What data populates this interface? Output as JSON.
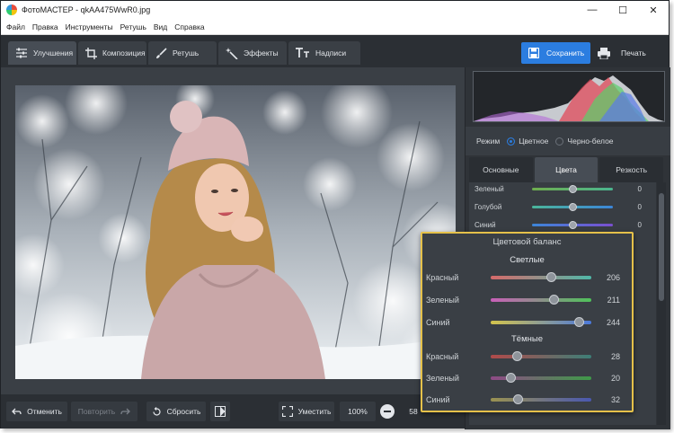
{
  "window": {
    "title": "ФотоМАСТЕР - qkAA475WwR0.jpg",
    "controls": [
      "—",
      "☐",
      "✕"
    ]
  },
  "menu": [
    "Файл",
    "Правка",
    "Инструменты",
    "Ретушь",
    "Вид",
    "Справка"
  ],
  "tabs": [
    {
      "label": "Улучшения",
      "icon": "sliders-icon",
      "active": true
    },
    {
      "label": "Композиция",
      "icon": "crop-icon",
      "active": false
    },
    {
      "label": "Ретушь",
      "icon": "brush-icon",
      "active": false
    },
    {
      "label": "Эффекты",
      "icon": "magic-wand-icon",
      "active": false
    },
    {
      "label": "Надписи",
      "icon": "text-icon",
      "active": false
    }
  ],
  "toolbar": {
    "save_label": "Сохранить",
    "print_label": "Печать"
  },
  "bottom": {
    "undo_label": "Отменить",
    "redo_label": "Повторить",
    "reset_label": "Сбросить",
    "fit_label": "Уместить",
    "zoom_label": "100%",
    "zoom_partial": "58"
  },
  "panel": {
    "mode_label": "Режим",
    "mode_options": [
      {
        "label": "Цветное",
        "selected": true
      },
      {
        "label": "Черно-белое",
        "selected": false
      }
    ],
    "tabs": [
      {
        "label": "Основные",
        "active": false
      },
      {
        "label": "Цвета",
        "active": true
      },
      {
        "label": "Резкость",
        "active": false
      }
    ],
    "rows": [
      {
        "label": "Зеленый",
        "value": "0",
        "fraction": 0.5
      },
      {
        "label": "Голубой",
        "value": "0",
        "fraction": 0.5
      },
      {
        "label": "Синий",
        "value": "0",
        "fraction": 0.5
      }
    ]
  },
  "color_balance": {
    "title": "Цветовой баланс",
    "light_title": "Светлые",
    "dark_title": "Тёмные",
    "light": [
      {
        "label": "Красный",
        "value": "206",
        "fraction": 0.6
      },
      {
        "label": "Зеленый",
        "value": "211",
        "fraction": 0.63
      },
      {
        "label": "Синий",
        "value": "244",
        "fraction": 0.88
      }
    ],
    "dark": [
      {
        "label": "Красный",
        "value": "28",
        "fraction": 0.26
      },
      {
        "label": "Зеленый",
        "value": "20",
        "fraction": 0.2
      },
      {
        "label": "Синий",
        "value": "32",
        "fraction": 0.27
      }
    ]
  },
  "colors": {
    "accent": "#2b7de0",
    "callout_border": "#e5c14a"
  }
}
